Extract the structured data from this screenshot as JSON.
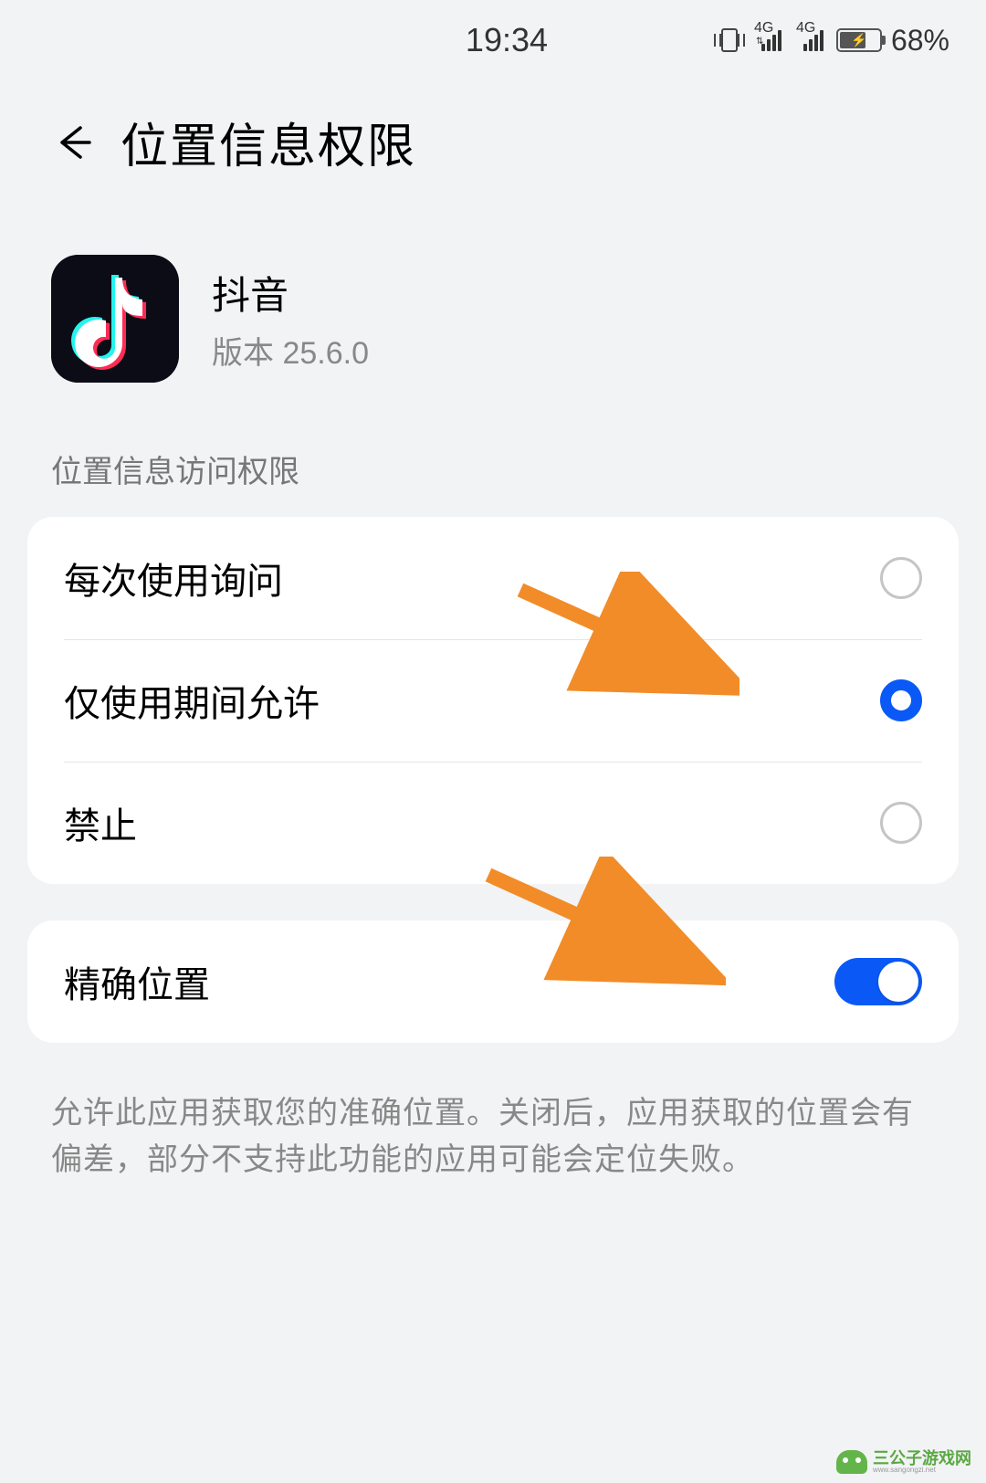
{
  "status": {
    "time": "19:34",
    "net1_label": "4G",
    "net2_label": "4G",
    "battery_pct": "68%"
  },
  "header": {
    "title": "位置信息权限"
  },
  "app": {
    "name": "抖音",
    "version_label": "版本 25.6.0"
  },
  "section_label": "位置信息访问权限",
  "options": [
    {
      "label": "每次使用询问",
      "selected": false
    },
    {
      "label": "仅使用期间允许",
      "selected": true
    },
    {
      "label": "禁止",
      "selected": false
    }
  ],
  "precise": {
    "label": "精确位置",
    "enabled": true
  },
  "description": "允许此应用获取您的准确位置。关闭后，应用获取的位置会有偏差，部分不支持此功能的应用可能会定位失败。",
  "watermark": {
    "title": "三公子游戏网",
    "sub": "www.sangongzi.net"
  }
}
